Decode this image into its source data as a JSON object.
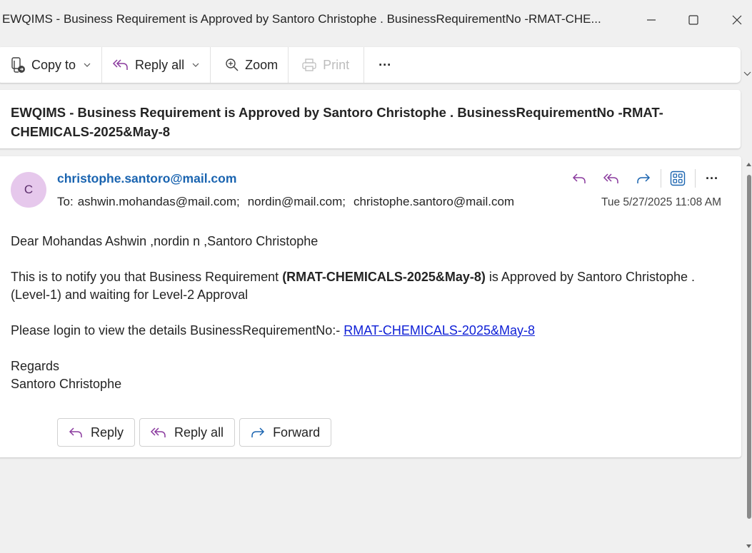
{
  "window": {
    "title": "EWQIMS - Business Requirement is Approved by Santoro Christophe . BusinessRequirementNo -RMAT-CHE..."
  },
  "toolbar": {
    "copy_to": "Copy to",
    "reply_all": "Reply all",
    "zoom": "Zoom",
    "print": "Print",
    "more": "···"
  },
  "subject": "EWQIMS - Business Requirement is Approved by Santoro Christophe . BusinessRequirementNo -RMAT-CHEMICALS-2025&May-8",
  "message": {
    "avatar_initial": "C",
    "sender": "christophe.santoro@mail.com",
    "to_label": "To:",
    "recipients": [
      "ashwin.mohandas@mail.com;",
      "nordin@mail.com;",
      "christophe.santoro@mail.com"
    ],
    "date": "Tue 5/27/2025 11:08 AM",
    "greeting": "Dear Mohandas Ashwin ,nordin n ,Santoro Christophe",
    "notify_prefix": "This is to notify you that Business Requirement ",
    "notify_bold": "(RMAT-CHEMICALS-2025&May-8)",
    "notify_suffix": " is Approved by Santoro Christophe .",
    "notify_line2": "(Level-1) and waiting for Level-2 Approval",
    "login_prefix": "Please login to view the details BusinessRequirementNo:- ",
    "login_link": "RMAT-CHEMICALS-2025&May-8",
    "regards": "Regards",
    "signature": "Santoro Christophe"
  },
  "bottom_actions": {
    "reply": "Reply",
    "reply_all": "Reply all",
    "forward": "Forward"
  },
  "colors": {
    "accent_purple": "#8a3a9e",
    "accent_blue": "#1a64b0",
    "link": "#0e1fd6",
    "avatar_bg": "#e6c8ec"
  }
}
